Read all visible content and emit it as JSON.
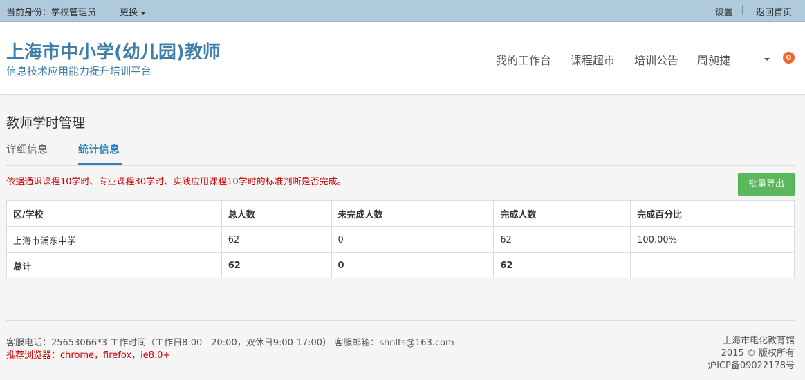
{
  "topbar": {
    "identity_label": "当前身份：学校管理员",
    "change_label": "更换",
    "settings_label": "设置",
    "separator": "|",
    "home_label": "返回首页"
  },
  "header": {
    "title": "上海市中小学(幼儿园)教师",
    "subtitle": "信息技术应用能力提升培训平台",
    "nav": [
      "我的工作台",
      "课程超市",
      "培训公告",
      "周昶捷"
    ],
    "notification_count": "0"
  },
  "main": {
    "page_title": "教师学时管理",
    "tabs": [
      "详细信息",
      "统计信息"
    ],
    "active_tab": "统计信息",
    "notice": "依据通识课程10学时、专业课程30学时、实践应用课程10学时的标准判断是否完成。",
    "export_button": "批量导出",
    "table": {
      "headers": [
        "区/学校",
        "总人数",
        "未完成人数",
        "完成人数",
        "完成百分比"
      ],
      "rows": [
        [
          "上海市浦东中学",
          "62",
          "0",
          "62",
          "100.00%"
        ]
      ],
      "total": [
        "总计",
        "62",
        "0",
        "62",
        ""
      ]
    }
  },
  "footer": {
    "contact": "客服电话：25653066*3 工作时间（工作日8:00—20:00，双休日9:00-17:00） 客服邮箱：shnlts@163.com",
    "browsers": "推荐浏览器：chrome，firefox，ie8.0+",
    "org": "上海市电化教育馆",
    "copyright": "2015 © 版权所有",
    "icp": "沪ICP备09022178号"
  },
  "colors": {
    "topbar_bg": "#afc9dd",
    "brand_blue": "#3f7fa7",
    "active_tab": "#2f86b8",
    "notice_red": "#cc0000",
    "export_green": "#5cb85c",
    "badge_orange": "#f0632b"
  }
}
